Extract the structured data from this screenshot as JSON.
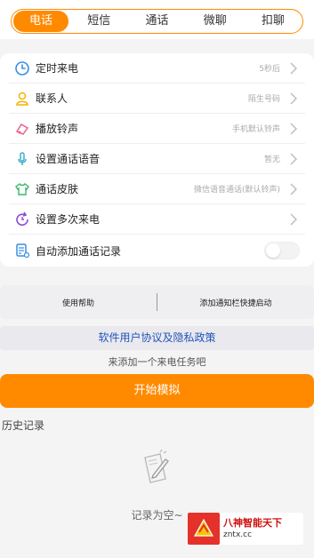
{
  "tabs": [
    {
      "label": "电话",
      "active": true
    },
    {
      "label": "短信",
      "active": false
    },
    {
      "label": "通话",
      "active": false
    },
    {
      "label": "微聊",
      "active": false
    },
    {
      "label": "扣聊",
      "active": false
    }
  ],
  "settings": {
    "items": [
      {
        "label": "定时来电",
        "value": "5秒后",
        "icon": "clock-icon"
      },
      {
        "label": "联系人",
        "value": "陌生号码",
        "icon": "contact-icon"
      },
      {
        "label": "播放铃声",
        "value": "手机默认铃声",
        "icon": "ringtone-icon"
      },
      {
        "label": "设置通话语音",
        "value": "暂无",
        "icon": "microphone-icon"
      },
      {
        "label": "通话皮肤",
        "value": "微信语音通话(默认铃声)",
        "icon": "shirt-icon"
      },
      {
        "label": "设置多次来电",
        "value": "",
        "icon": "repeat-call-icon"
      },
      {
        "label": "自动添加通话记录",
        "value": "",
        "icon": "record-icon",
        "toggle": false
      }
    ]
  },
  "helpbar": {
    "left": "使用帮助",
    "right": "添加通知栏快捷启动"
  },
  "policy_label": "软件用户协议及隐私政策",
  "hint": "来添加一个来电任务吧",
  "start_button": "开始模拟",
  "history": {
    "title": "历史记录",
    "empty": "记录为空~"
  },
  "watermark": {
    "main": "八神智能天下",
    "sub": "zntx.cc"
  },
  "colors": {
    "accent": "#ff8a00",
    "link": "#2255bb"
  }
}
